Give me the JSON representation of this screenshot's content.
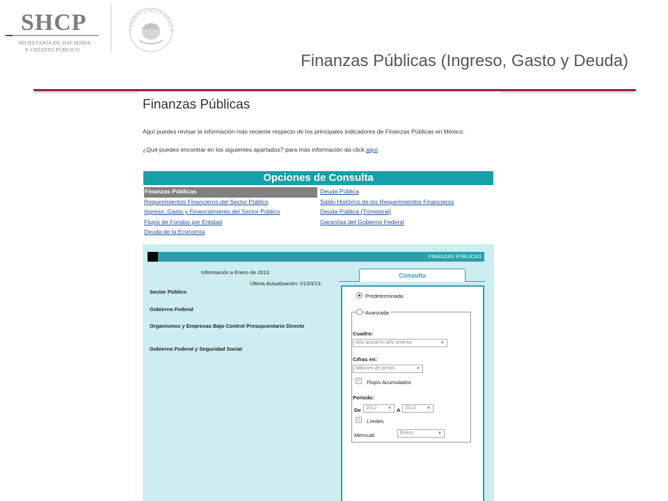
{
  "header": {
    "logo_text": "SHCP",
    "logo_sub1": "SECRETARÍA DE HACIENDA",
    "logo_sub2": "Y CRÉDITO PÚBLICO",
    "seal_text": "ESTADOS UNIDOS MEXICANOS",
    "slide_title": "Finanzas Públicas (Ingreso, Gasto y Deuda)"
  },
  "page": {
    "title": "Finanzas Públicas",
    "intro": "Aquí puedes revisar la información más reciente respecto de los principales indicadores de Finanzas Públicas en México.",
    "intro2_prefix": "¿Qué puedes encontrar en los siguientes apartados? para más información da click ",
    "intro2_link": "aquí",
    "intro2_suffix": "."
  },
  "options": {
    "title": "Opciones de Consulta",
    "left": [
      "Finanzas Públicas",
      "Requerimientos Financieros del Sector Público",
      "Ingreso, Gasto y Financiamiento del Sector Público",
      "Flujos de Fondos por Entidad",
      "Deuda de la Economía"
    ],
    "right": [
      "Deuda Pública",
      "Saldo Histórico de los Requerimientos Financieros",
      "Deuda Pública (Trimestral)",
      "Garantías del Gobierno Federal"
    ]
  },
  "panel": {
    "bar_label": "FINANZAS PÚBLICAS",
    "info_date": "Información a Enero de 2013",
    "last_update": "Última Actualización: 01/03/13",
    "sections": [
      "Sector Público",
      "Gobierno Federal",
      "Organismos y Empresas Bajo Control Presupuestario Directo",
      "Gobierno Federal y Seguridad Social"
    ]
  },
  "consulta": {
    "tab_label": "Consulta",
    "predeterminada": "Predeterminada",
    "avanzada": "Avanzada",
    "cuadro_label": "Cuadro:",
    "cuadro_value": "Año actual vs año anterior",
    "cifras_label": "Cifras en:",
    "cifras_value": "Millones de pesos",
    "flujos_label": "Flujos Acumulados",
    "periodo_label": "Periodo:",
    "de_label": "De",
    "de_value": "2012",
    "a_label": "A",
    "a_value": "2013",
    "limites_label": "Límites",
    "mensual_label": "Mensual:",
    "mensual_value": "Enero"
  },
  "colors": {
    "accent": "#a31d3c",
    "teal": "#16a0a7",
    "panel_bg": "#cdedf0",
    "link": "#1a4d99"
  }
}
